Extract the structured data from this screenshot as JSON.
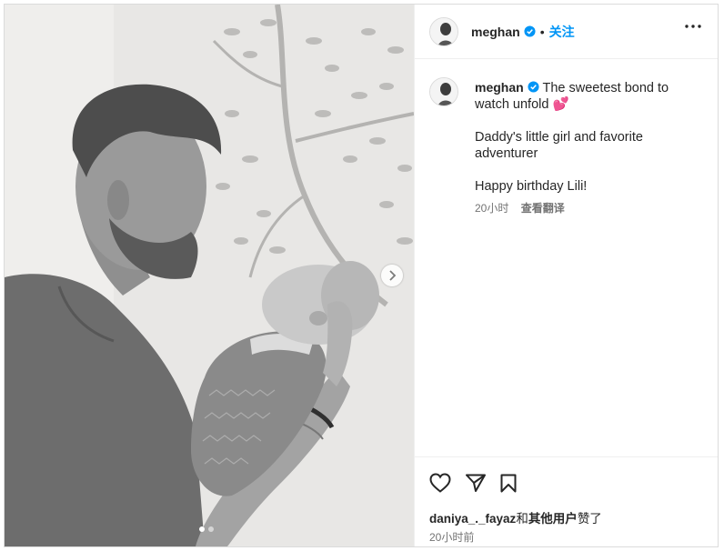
{
  "post": {
    "username": "meghan",
    "separator": "•",
    "follow_label": "关注",
    "caption_line1": "The sweetest bond to watch unfold 💕",
    "caption_line2": "Daddy's little girl and favorite adventurer",
    "caption_line3": "Happy birthday Lili!",
    "comment_time": "20小时",
    "translate_label": "查看翻译",
    "liked_by_user": "daniya_._fayaz",
    "liked_by_conj": "和",
    "liked_by_others": "其他用户",
    "liked_by_suffix": "赞了",
    "post_time": "20小时前"
  },
  "carousel": {
    "current_slide": 1,
    "total_slides": 2
  },
  "colors": {
    "link_blue": "#0095f6",
    "verified_blue": "#0095f6",
    "muted_text": "#737373",
    "border": "#dbdbdb"
  },
  "icons": [
    "verified-badge-icon",
    "more-options-icon",
    "carousel-next-icon",
    "heart-icon",
    "share-icon",
    "bookmark-icon"
  ]
}
